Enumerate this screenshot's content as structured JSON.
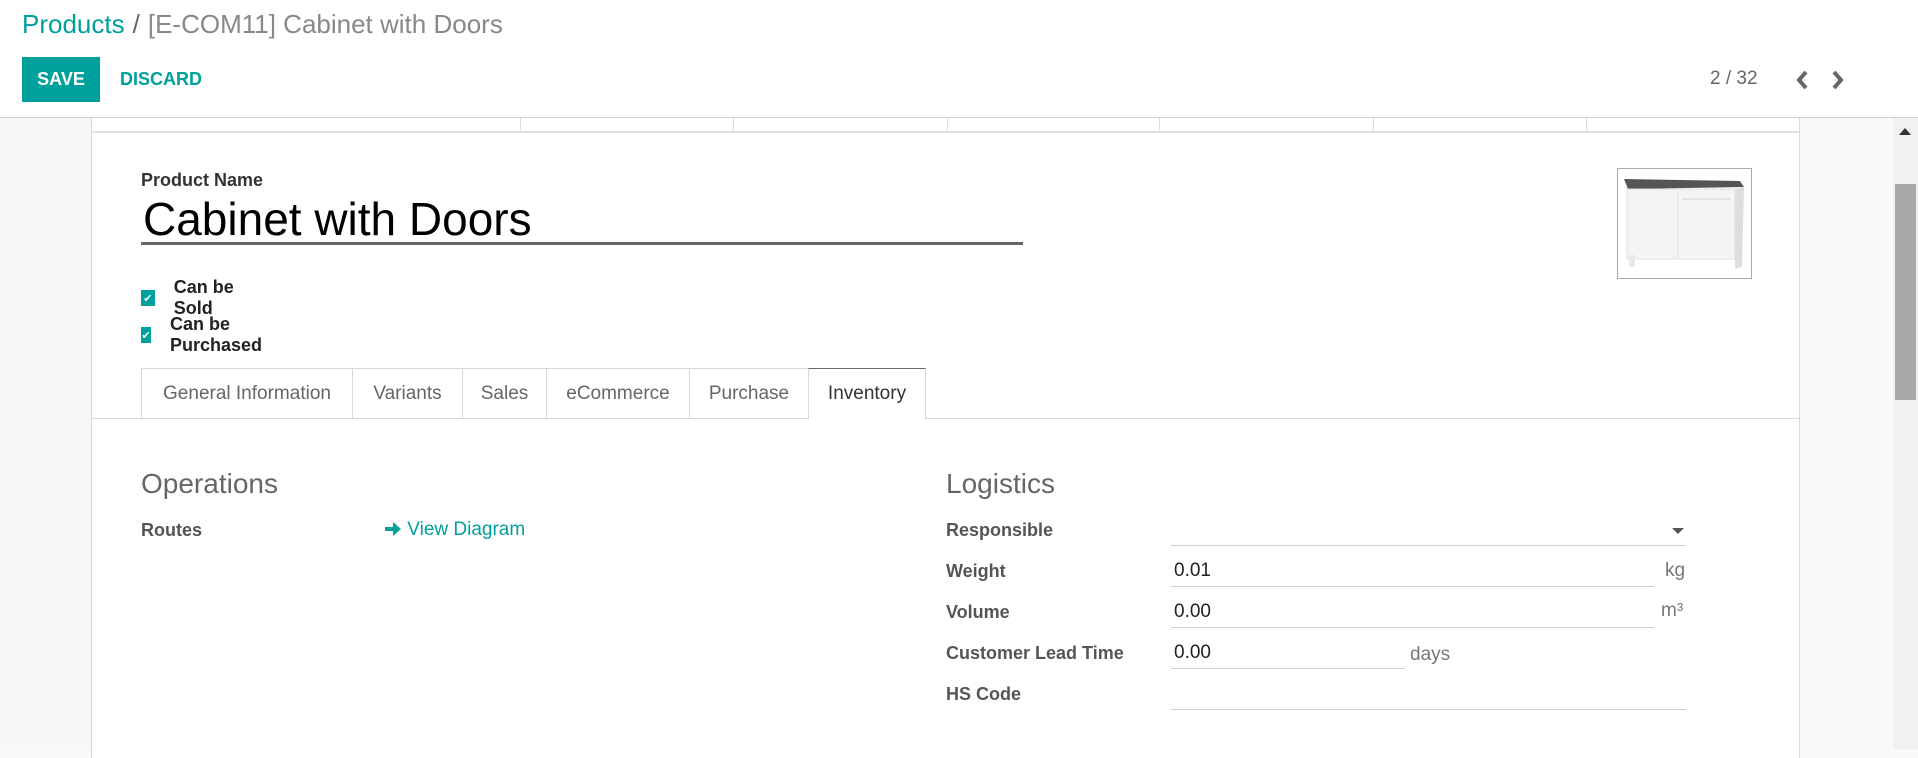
{
  "breadcrumb": {
    "parent": "Products",
    "separator": "/",
    "current": "[E-COM11] Cabinet with Doors"
  },
  "toolbar": {
    "save_label": "SAVE",
    "discard_label": "DISCARD"
  },
  "pager": {
    "value": "2 / 32",
    "prev_icon": "chevron-left-icon",
    "next_icon": "chevron-right-icon"
  },
  "form": {
    "product_name_label": "Product Name",
    "product_name_value": "Cabinet with Doors",
    "can_be_sold_label": "Can be Sold",
    "can_be_sold_checked": true,
    "can_be_purchased_label": "Can be Purchased",
    "can_be_purchased_checked": true,
    "image_alt": "Cabinet with Doors product image"
  },
  "tabs": [
    {
      "label": "General Information",
      "active": false
    },
    {
      "label": "Variants",
      "active": false
    },
    {
      "label": "Sales",
      "active": false
    },
    {
      "label": "eCommerce",
      "active": false
    },
    {
      "label": "Purchase",
      "active": false
    },
    {
      "label": "Inventory",
      "active": true
    }
  ],
  "inventory": {
    "operations": {
      "title": "Operations",
      "routes_label": "Routes",
      "view_diagram_label": "View Diagram",
      "view_diagram_icon": "arrow-right-icon"
    },
    "logistics": {
      "title": "Logistics",
      "responsible_label": "Responsible",
      "responsible_value": "",
      "weight_label": "Weight",
      "weight_value": "0.01",
      "weight_unit": "kg",
      "volume_label": "Volume",
      "volume_value": "0.00",
      "volume_unit": "m³",
      "lead_time_label": "Customer Lead Time",
      "lead_time_value": "0.00",
      "lead_time_unit": "days",
      "hs_code_label": "HS Code",
      "hs_code_value": ""
    }
  },
  "colors": {
    "brand": "#00A09D"
  }
}
